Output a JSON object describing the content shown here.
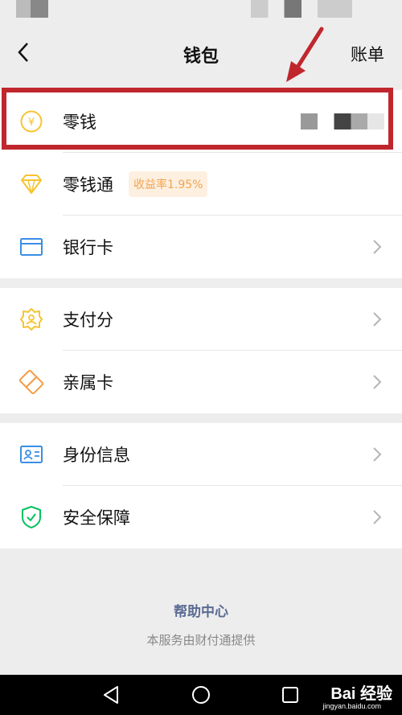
{
  "header": {
    "title": "钱包",
    "bill_label": "账单"
  },
  "wallet_items": [
    {
      "label": "零钱",
      "icon": "yen-coin-icon"
    },
    {
      "label": "零钱通",
      "icon": "diamond-icon",
      "badge": "收益率1.95%"
    },
    {
      "label": "银行卡",
      "icon": "bank-card-icon"
    }
  ],
  "service_items": [
    {
      "label": "支付分",
      "icon": "pay-score-icon"
    },
    {
      "label": "亲属卡",
      "icon": "family-card-icon"
    }
  ],
  "security_items": [
    {
      "label": "身份信息",
      "icon": "id-card-icon"
    },
    {
      "label": "安全保障",
      "icon": "shield-check-icon"
    }
  ],
  "footer": {
    "help_center": "帮助中心",
    "provider": "本服务由财付通提供"
  },
  "watermark": {
    "brand": "Bai 经验",
    "url": "jingyan.baidu.com"
  },
  "colors": {
    "highlight": "#c0272d",
    "badge_text": "#f2a34f",
    "help_link": "#5b6b93",
    "yellow_icon": "#f7c430",
    "blue_icon": "#3a8ee6",
    "orange_icon": "#f59b42",
    "green_icon": "#07c160"
  }
}
